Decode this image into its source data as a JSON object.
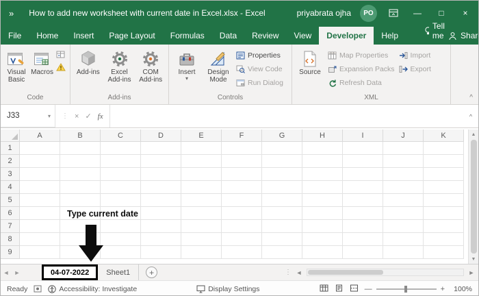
{
  "titlebar": {
    "title": "How to add new worksheet with current date in Excel.xlsx  -  Excel",
    "user": "priyabrata ojha",
    "avatar": "PO"
  },
  "tabs": [
    {
      "label": "File"
    },
    {
      "label": "Home"
    },
    {
      "label": "Insert"
    },
    {
      "label": "Page Layout"
    },
    {
      "label": "Formulas"
    },
    {
      "label": "Data"
    },
    {
      "label": "Review"
    },
    {
      "label": "View"
    },
    {
      "label": "Developer"
    },
    {
      "label": "Help"
    }
  ],
  "tellme": "Tell me",
  "share": "Share",
  "ribbon": {
    "code": {
      "group_label": "Code",
      "visual_basic": "Visual Basic",
      "macros": "Macros"
    },
    "addins": {
      "group_label": "Add-ins",
      "addins": "Add-ins",
      "excel_addins": "Excel Add-ins",
      "com_addins": "COM Add-ins"
    },
    "controls": {
      "group_label": "Controls",
      "insert": "Insert",
      "design_mode": "Design Mode",
      "properties": "Properties",
      "view_code": "View Code",
      "run_dialog": "Run Dialog"
    },
    "xml": {
      "group_label": "XML",
      "source": "Source",
      "map_properties": "Map Properties",
      "expansion_packs": "Expansion Packs",
      "refresh_data": "Refresh Data",
      "import": "Import",
      "export": "Export"
    }
  },
  "formula_bar": {
    "name_box": "J33",
    "fx": "fx"
  },
  "grid": {
    "columns": [
      "A",
      "B",
      "C",
      "D",
      "E",
      "F",
      "G",
      "H",
      "I",
      "J",
      "K"
    ],
    "rows": [
      "1",
      "2",
      "3",
      "4",
      "5",
      "6",
      "7",
      "8",
      "9"
    ],
    "annotation_text": "Type current date"
  },
  "sheet_bar": {
    "tabs": [
      {
        "label": "04-07-2022"
      },
      {
        "label": "Sheet1"
      }
    ]
  },
  "status": {
    "ready": "Ready",
    "accessibility": "Accessibility: Investigate",
    "display_settings": "Display Settings",
    "zoom": "100%"
  },
  "glyphs": {
    "qat_chevrons": "»",
    "minimize": "—",
    "maximize": "□",
    "close": "×",
    "dropdown": "▾",
    "collapse": "^",
    "cancel": "×",
    "enter": "✓",
    "dots": "⋮",
    "nav_left": "◄",
    "nav_right": "►",
    "up": "▲",
    "down": "▼",
    "add_sheet": "+",
    "minus": "—",
    "plus": "+"
  }
}
